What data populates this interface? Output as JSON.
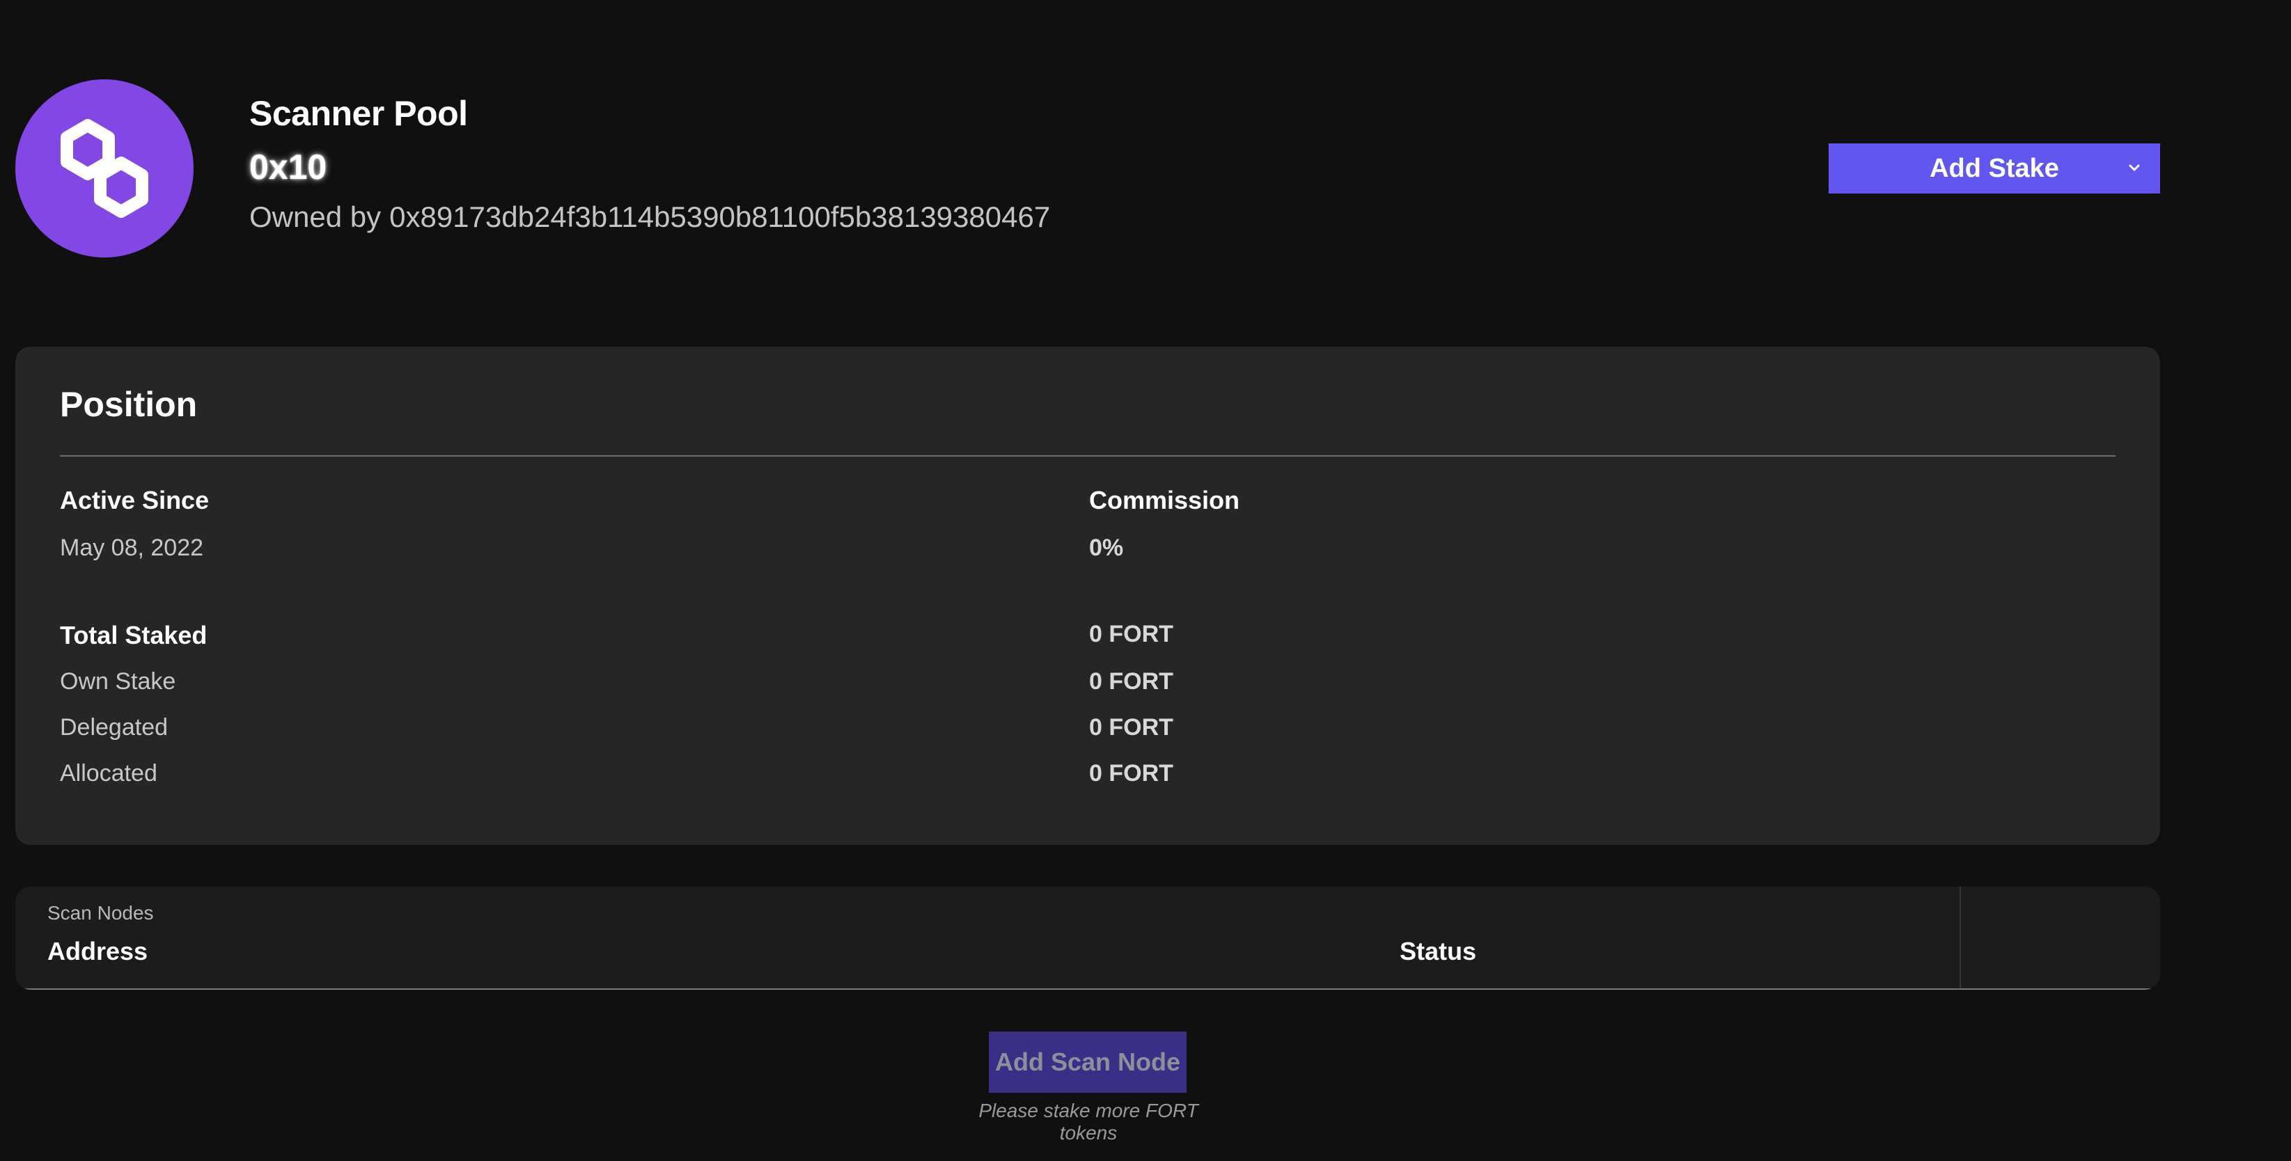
{
  "header": {
    "avatar_icon": "polygon-logo-icon",
    "avatar_color": "#8247e5",
    "pool_type": "Scanner Pool",
    "pool_id": "0x10",
    "owner_label": "Owned by",
    "owner_address": "0x89173db24f3b114b5390b81100f5b38139380467"
  },
  "actions": {
    "add_stake_label": "Add Stake",
    "add_stake_color": "#6157f0",
    "dropdown_icon": "chevron-down-icon"
  },
  "position": {
    "title": "Position",
    "active_since_label": "Active Since",
    "active_since_value": "May 08, 2022",
    "commission_label": "Commission",
    "commission_value": "0%",
    "total_staked_label": "Total Staked",
    "total_staked_value": "0 FORT",
    "own_stake_label": "Own Stake",
    "own_stake_value": "0 FORT",
    "delegated_label": "Delegated",
    "delegated_value": "0 FORT",
    "allocated_label": "Allocated",
    "allocated_value": "0 FORT"
  },
  "scan_nodes": {
    "caption": "Scan Nodes",
    "columns": [
      "Address",
      "Status"
    ],
    "rows": [],
    "add_button_label": "Add Scan Node",
    "add_button_disabled": true,
    "hint": "Please stake more FORT tokens"
  }
}
